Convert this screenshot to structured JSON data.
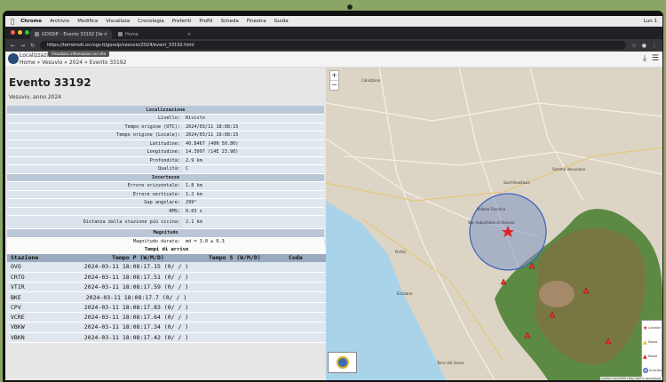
{
  "menubar": {
    "app": "Chrome",
    "items": [
      "Archivio",
      "Modifica",
      "Visualizza",
      "Cronologia",
      "Preferiti",
      "Profili",
      "Scheda",
      "Finestra",
      "Guida"
    ],
    "clock": "Lun 1"
  },
  "browser": {
    "tabs": [
      "GOSSIP – Evento 33192 [Ve",
      "Home"
    ],
    "url": "https://terremoti.ov.ingv.it/gossip/vesuvio/2024/event_33192.html",
    "tooltip": "Visualizza informazioni sul sito"
  },
  "site": {
    "title": "Localizzazione",
    "breadcrumb": "Home » Vesuvio » 2024 » Evento 33192"
  },
  "event": {
    "title": "Evento 33192",
    "subtitle": "Vesuvio, anno 2024"
  },
  "sections": {
    "localizzazione": "Localizzazione",
    "incertezze": "Incertezze",
    "magnitudo": "Magnitudo",
    "tempi": "Tempi di arrivo"
  },
  "localizzazione": [
    {
      "k": "Livello:",
      "v": "Rivisto"
    },
    {
      "k": "Tempo origine (UTC):",
      "v": "2024/03/11 18:08:15"
    },
    {
      "k": "Tempo origine (Locale):",
      "v": "2024/03/11 19:08:15"
    },
    {
      "k": "Latitudine:",
      "v": "40.8467 (40N 50.80)"
    },
    {
      "k": "Longitudine:",
      "v": "14.3997 (14E 23.98)"
    },
    {
      "k": "Profondità:",
      "v": "2.9 km"
    },
    {
      "k": "Qualità:",
      "v": "C"
    }
  ],
  "incertezze": [
    {
      "k": "Errore orizzontale:",
      "v": "1.8 km"
    },
    {
      "k": "Errore verticale:",
      "v": "1.2 km"
    },
    {
      "k": "Gap angolare:",
      "v": "299°"
    },
    {
      "k": "RMS:",
      "v": "0.03 s"
    },
    {
      "k": "Distanza dalla stazione più vicina:",
      "v": "2.1 km"
    }
  ],
  "magnitudo": [
    {
      "k": "Magnitudo durata:",
      "v": "md = 3.0 ± 0.3"
    }
  ],
  "stations": {
    "headers": [
      "Stazione",
      "Tempo P (W/M/D)",
      "Tempo S (W/M/D)",
      "Coda"
    ],
    "rows": [
      {
        "name": "OVO",
        "p": "2024-03-11 18:08:17.15 (0/ / )"
      },
      {
        "name": "CRTO",
        "p": "2024-03-11 18:08:17.51 (0/ / )"
      },
      {
        "name": "VTIR",
        "p": "2024-03-11 18:08:17.59 (0/ / )"
      },
      {
        "name": "BKE",
        "p": "2024-03-11 18:08:17.7 (0/ / )"
      },
      {
        "name": "CPV",
        "p": "2024-03-11 18:08:17.83 (0/ / )"
      },
      {
        "name": "VCRE",
        "p": "2024-03-11 18:08:17.64 (0/ / )"
      },
      {
        "name": "VBKW",
        "p": "2024-03-11 18:08:17.34 (0/ / )"
      },
      {
        "name": "VBKN",
        "p": "2024-03-11 18:08:17.42 (0/ / )"
      }
    ]
  },
  "map": {
    "labels": [
      "Calvizzano",
      "Sant'Anastasia",
      "Somma Vesuviana",
      "Pollena Trocchia",
      "San Sebastiano al Vesuvio",
      "Portici",
      "Ercolano",
      "Torre del Greco"
    ],
    "legend": [
      "Localizz",
      "Stazio",
      "Stazio",
      "Incertez"
    ],
    "attribution": "Leaflet | OpenSTM | Map data © OpenStreet",
    "zoom_in": "+",
    "zoom_out": "−",
    "colors": {
      "sea": "#a9d3e9",
      "volcano": "#4e7a3a",
      "uncertainty": "#7f93c4"
    }
  }
}
